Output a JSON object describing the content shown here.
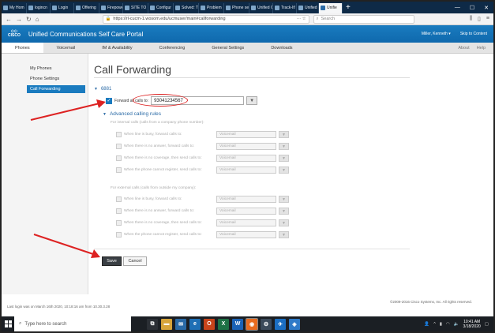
{
  "browser": {
    "tabs": [
      {
        "label": "My Hom",
        "active": false
      },
      {
        "label": "logincn",
        "active": false
      },
      {
        "label": "Login",
        "active": false
      },
      {
        "label": "Offering",
        "active": false
      },
      {
        "label": "Firepowe",
        "active": false
      },
      {
        "label": "SITE TO",
        "active": false
      },
      {
        "label": "Configur",
        "active": false
      },
      {
        "label": "Solved: T",
        "active": false
      },
      {
        "label": "Problem",
        "active": false
      },
      {
        "label": "Phone se",
        "active": false
      },
      {
        "label": "Unified C",
        "active": false
      },
      {
        "label": "Track-It!",
        "active": false
      },
      {
        "label": "Unified C",
        "active": false
      },
      {
        "label": "Unifie",
        "active": true
      }
    ],
    "new_tab": "+",
    "url": "https://rl-cucm-1.wosom.edu/ucmuser/main#callforwarding",
    "search_placeholder": "Search"
  },
  "app": {
    "title": "Unified Communications Self Care Portal",
    "logo_word": "CISCO",
    "user": "Miller, Kenneth ▾",
    "skip": "Skip to Content",
    "nav": [
      "Phones",
      "Voicemail",
      "IM & Availability",
      "Conferencing",
      "General Settings",
      "Downloads"
    ],
    "nav_right": [
      "About",
      "Help"
    ]
  },
  "sidebar": {
    "items": [
      "My Phones",
      "Phone Settings",
      "Call Forwarding"
    ]
  },
  "main": {
    "title": "Call Forwarding",
    "line": "6881",
    "forward_label": "Forward all calls to:",
    "forward_number": "93041234567",
    "advanced": "Advanced calling rules",
    "internal_heading": "For internal calls (calls from a company phone number):",
    "external_heading": "For external calls (calls from outside my company):",
    "rules": [
      "When line is busy, forward calls to:",
      "When there is no answer, forward calls to:",
      "When there is no coverage, then send calls to:",
      "When the phone cannot register, send calls to:"
    ],
    "rule_value": "Voicemail",
    "save": "Save",
    "cancel": "Cancel"
  },
  "footer": {
    "last_login": "Last login was on March 16th 2020, 10:18:16 am from 10.30.3.28",
    "copyright": "©2009-2016 Cisco Systems, Inc. All rights reserved."
  },
  "taskbar": {
    "search_placeholder": "Type here to search",
    "time": "10:41 AM",
    "date": "3/18/2020"
  },
  "colors": {
    "cisco_blue": "#1a7bbf",
    "annotation_red": "#dd2222",
    "tab_strip": "#0e2a47"
  }
}
